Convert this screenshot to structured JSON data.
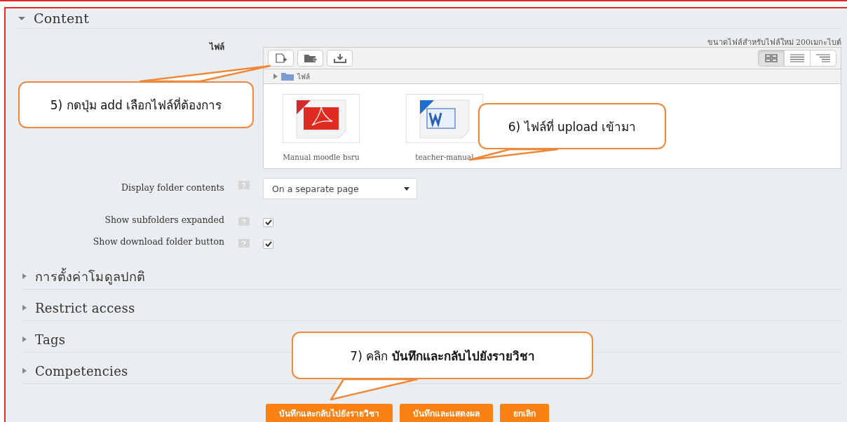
{
  "sections": [
    {
      "title": "Content",
      "expanded": true
    },
    {
      "title": "การตั้งค่าโมดูลปกติ",
      "expanded": false
    },
    {
      "title": "Restrict access",
      "expanded": false
    },
    {
      "title": "Tags",
      "expanded": false
    },
    {
      "title": "Competencies",
      "expanded": false
    }
  ],
  "files_field": {
    "label": "ไฟล์",
    "size_note": "ขนาดไฟล์สำหรับไฟล์ใหม่ 200เมกะไบต์",
    "breadcrumb": "ไฟล์",
    "view_modes": [
      {
        "kind": "icons",
        "selected": true
      },
      {
        "kind": "list",
        "selected": false
      },
      {
        "kind": "tree",
        "selected": false
      }
    ],
    "files": [
      {
        "name": "Manual moodle bsru",
        "kind": "pdf"
      },
      {
        "name": "teacher-manual",
        "kind": "doc"
      }
    ]
  },
  "settings": [
    {
      "kind": "select",
      "label": "Display folder contents",
      "value": "On a separate page"
    },
    {
      "kind": "checkbox",
      "label": "Show subfolders expanded",
      "checked": true
    },
    {
      "kind": "checkbox",
      "label": "Show download folder button",
      "checked": true
    }
  ],
  "buttons": [
    "บันทึกและกลับไปยังรายวิชา",
    "บันทึกและแสดงผล",
    "ยกเลิก"
  ],
  "callouts": [
    {
      "text": "5) กดปุ่ม add เลือกไฟล์ที่ต้องการ"
    },
    {
      "text": "6) ไฟล์ที่ upload เข้ามา"
    },
    {
      "text": "7) คลิก **บันทึกและกลับไปยังรายวิชา**"
    }
  ]
}
